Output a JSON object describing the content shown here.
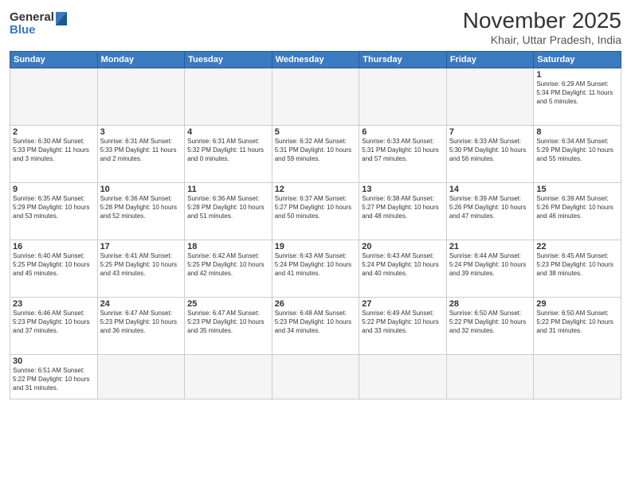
{
  "logo": {
    "line1": "General",
    "line2": "Blue"
  },
  "title": "November 2025",
  "location": "Khair, Uttar Pradesh, India",
  "days_of_week": [
    "Sunday",
    "Monday",
    "Tuesday",
    "Wednesday",
    "Thursday",
    "Friday",
    "Saturday"
  ],
  "weeks": [
    [
      {
        "day": "",
        "info": ""
      },
      {
        "day": "",
        "info": ""
      },
      {
        "day": "",
        "info": ""
      },
      {
        "day": "",
        "info": ""
      },
      {
        "day": "",
        "info": ""
      },
      {
        "day": "",
        "info": ""
      },
      {
        "day": "1",
        "info": "Sunrise: 6:29 AM\nSunset: 5:34 PM\nDaylight: 11 hours and 5 minutes."
      }
    ],
    [
      {
        "day": "2",
        "info": "Sunrise: 6:30 AM\nSunset: 5:33 PM\nDaylight: 11 hours and 3 minutes."
      },
      {
        "day": "3",
        "info": "Sunrise: 6:31 AM\nSunset: 5:33 PM\nDaylight: 11 hours and 2 minutes."
      },
      {
        "day": "4",
        "info": "Sunrise: 6:31 AM\nSunset: 5:32 PM\nDaylight: 11 hours and 0 minutes."
      },
      {
        "day": "5",
        "info": "Sunrise: 6:32 AM\nSunset: 5:31 PM\nDaylight: 10 hours and 59 minutes."
      },
      {
        "day": "6",
        "info": "Sunrise: 6:33 AM\nSunset: 5:31 PM\nDaylight: 10 hours and 57 minutes."
      },
      {
        "day": "7",
        "info": "Sunrise: 6:33 AM\nSunset: 5:30 PM\nDaylight: 10 hours and 56 minutes."
      },
      {
        "day": "8",
        "info": "Sunrise: 6:34 AM\nSunset: 5:29 PM\nDaylight: 10 hours and 55 minutes."
      }
    ],
    [
      {
        "day": "9",
        "info": "Sunrise: 6:35 AM\nSunset: 5:29 PM\nDaylight: 10 hours and 53 minutes."
      },
      {
        "day": "10",
        "info": "Sunrise: 6:36 AM\nSunset: 5:28 PM\nDaylight: 10 hours and 52 minutes."
      },
      {
        "day": "11",
        "info": "Sunrise: 6:36 AM\nSunset: 5:28 PM\nDaylight: 10 hours and 51 minutes."
      },
      {
        "day": "12",
        "info": "Sunrise: 6:37 AM\nSunset: 5:27 PM\nDaylight: 10 hours and 50 minutes."
      },
      {
        "day": "13",
        "info": "Sunrise: 6:38 AM\nSunset: 5:27 PM\nDaylight: 10 hours and 48 minutes."
      },
      {
        "day": "14",
        "info": "Sunrise: 6:39 AM\nSunset: 5:26 PM\nDaylight: 10 hours and 47 minutes."
      },
      {
        "day": "15",
        "info": "Sunrise: 6:39 AM\nSunset: 5:26 PM\nDaylight: 10 hours and 46 minutes."
      }
    ],
    [
      {
        "day": "16",
        "info": "Sunrise: 6:40 AM\nSunset: 5:25 PM\nDaylight: 10 hours and 45 minutes."
      },
      {
        "day": "17",
        "info": "Sunrise: 6:41 AM\nSunset: 5:25 PM\nDaylight: 10 hours and 43 minutes."
      },
      {
        "day": "18",
        "info": "Sunrise: 6:42 AM\nSunset: 5:25 PM\nDaylight: 10 hours and 42 minutes."
      },
      {
        "day": "19",
        "info": "Sunrise: 6:43 AM\nSunset: 5:24 PM\nDaylight: 10 hours and 41 minutes."
      },
      {
        "day": "20",
        "info": "Sunrise: 6:43 AM\nSunset: 5:24 PM\nDaylight: 10 hours and 40 minutes."
      },
      {
        "day": "21",
        "info": "Sunrise: 6:44 AM\nSunset: 5:24 PM\nDaylight: 10 hours and 39 minutes."
      },
      {
        "day": "22",
        "info": "Sunrise: 6:45 AM\nSunset: 5:23 PM\nDaylight: 10 hours and 38 minutes."
      }
    ],
    [
      {
        "day": "23",
        "info": "Sunrise: 6:46 AM\nSunset: 5:23 PM\nDaylight: 10 hours and 37 minutes."
      },
      {
        "day": "24",
        "info": "Sunrise: 6:47 AM\nSunset: 5:23 PM\nDaylight: 10 hours and 36 minutes."
      },
      {
        "day": "25",
        "info": "Sunrise: 6:47 AM\nSunset: 5:23 PM\nDaylight: 10 hours and 35 minutes."
      },
      {
        "day": "26",
        "info": "Sunrise: 6:48 AM\nSunset: 5:23 PM\nDaylight: 10 hours and 34 minutes."
      },
      {
        "day": "27",
        "info": "Sunrise: 6:49 AM\nSunset: 5:22 PM\nDaylight: 10 hours and 33 minutes."
      },
      {
        "day": "28",
        "info": "Sunrise: 6:50 AM\nSunset: 5:22 PM\nDaylight: 10 hours and 32 minutes."
      },
      {
        "day": "29",
        "info": "Sunrise: 6:50 AM\nSunset: 5:22 PM\nDaylight: 10 hours and 31 minutes."
      }
    ],
    [
      {
        "day": "30",
        "info": "Sunrise: 6:51 AM\nSunset: 5:22 PM\nDaylight: 10 hours and 31 minutes."
      },
      {
        "day": "",
        "info": ""
      },
      {
        "day": "",
        "info": ""
      },
      {
        "day": "",
        "info": ""
      },
      {
        "day": "",
        "info": ""
      },
      {
        "day": "",
        "info": ""
      },
      {
        "day": "",
        "info": ""
      }
    ]
  ]
}
